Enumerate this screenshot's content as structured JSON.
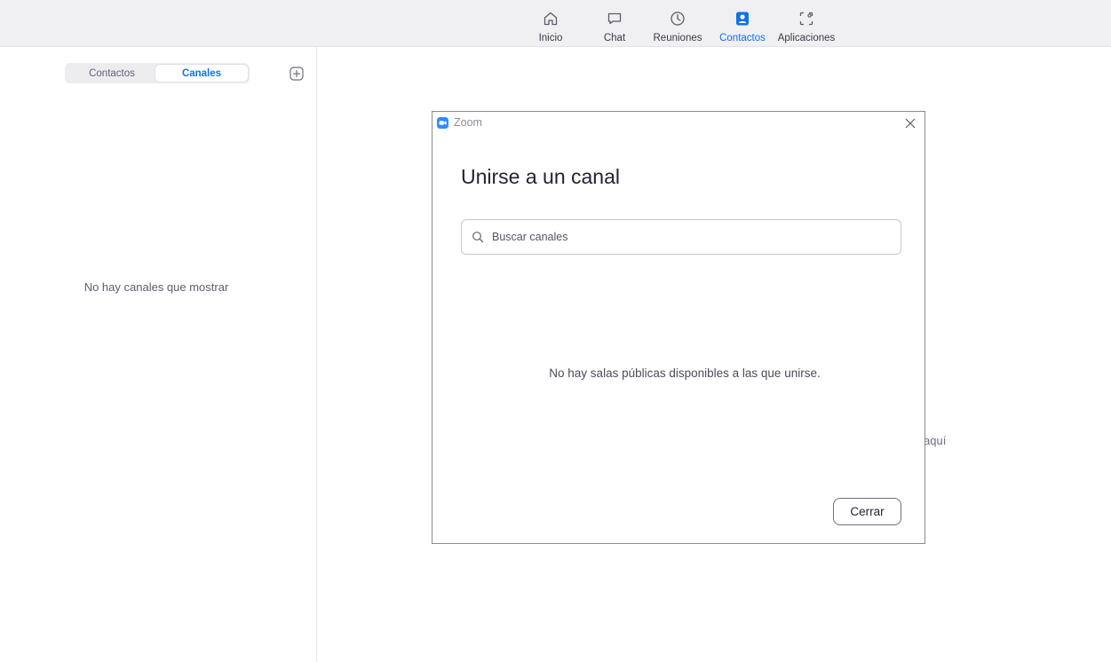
{
  "nav": {
    "items": [
      {
        "label": "Inicio",
        "icon": "home-icon"
      },
      {
        "label": "Chat",
        "icon": "chat-bubble-icon"
      },
      {
        "label": "Reuniones",
        "icon": "clock-icon"
      },
      {
        "label": "Contactos",
        "icon": "contact-card-icon",
        "active": true
      },
      {
        "label": "Aplicaciones",
        "icon": "apps-icon"
      }
    ]
  },
  "left_panel": {
    "tabs": [
      {
        "label": "Contactos",
        "selected": false
      },
      {
        "label": "Canales",
        "selected": true
      }
    ],
    "add_icon": "plus-square-icon",
    "empty_text": "No hay canales que mostrar"
  },
  "background": {
    "partial_text": "aquí"
  },
  "dialog": {
    "app_name": "Zoom",
    "heading": "Unirse a un canal",
    "search": {
      "placeholder": "Buscar canales",
      "value": ""
    },
    "empty_text": "No hay salas públicas disponibles a las que unirse.",
    "close_button": "Cerrar"
  },
  "colors": {
    "accent": "#0e71eb",
    "topbar_bg": "#f0f0f2",
    "text_primary": "#232333"
  }
}
